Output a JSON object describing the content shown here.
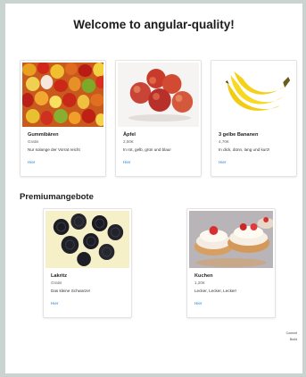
{
  "page": {
    "title": "Welcome to angular-quality!"
  },
  "products": [
    {
      "name": "Gummibären",
      "price": "Gratis",
      "description": "Nur solange der Vorrat reicht",
      "link": "Hier",
      "image_icon": "gummy-bears-icon"
    },
    {
      "name": "Äpfel",
      "price": "2,50€",
      "description": "In rot, gelb, grün und blau!",
      "link": "Hier",
      "image_icon": "apples-icon"
    },
    {
      "name": "3 gelbe Bananen",
      "price": "4,70€",
      "description": "In dick, dünn, lang und kurz!",
      "link": "Hier",
      "image_icon": "bananas-icon"
    }
  ],
  "premium": {
    "title": "Premiumangebote",
    "items": [
      {
        "name": "Lakritz",
        "price": "Gratis",
        "description": "Das kleine Schwarze!",
        "link": "Hier",
        "image_icon": "licorice-icon"
      },
      {
        "name": "Kuchen",
        "price": "1,20€",
        "description": "Lecker, Lecker, Lecker!",
        "link": "Hier",
        "image_icon": "cake-icon"
      }
    ]
  },
  "footer": {
    "commit_label": "Commit",
    "build_label": "Build"
  },
  "colors": {
    "link": "#2a7de1",
    "background": "#c9d3d0",
    "card_border": "#e3e3e3"
  }
}
